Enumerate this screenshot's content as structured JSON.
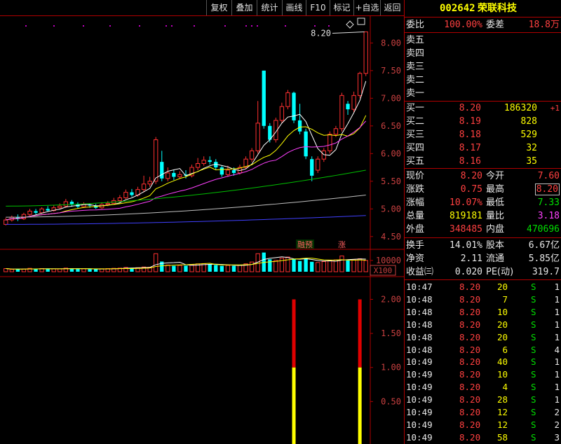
{
  "toolbar": {
    "buttons": [
      "复权",
      "叠加",
      "统计",
      "画线",
      "F10",
      "标记",
      "+自选",
      "返回"
    ]
  },
  "chart": {
    "price_axis": [
      "8.00",
      "7.50",
      "7.00",
      "6.50",
      "6.00",
      "5.50",
      "5.00",
      "4.50"
    ],
    "last_price_label": "8.20",
    "tag_left": "融预",
    "tag_right": "涨",
    "volume_axis": "10000",
    "volume_unit": "X100",
    "indicator_axis": [
      "2.00",
      "1.50",
      "1.00",
      "0.50"
    ],
    "colors": {
      "up": "#ff3030",
      "down": "#00ffff",
      "ma5": "#ffffff",
      "ma10": "#ffff00",
      "ma20": "#ff40ff",
      "ma30": "#00c000",
      "ma60": "#c0c0c0",
      "ma120": "#4040ff"
    },
    "candles": [
      {
        "o": 4.72,
        "c": 4.8,
        "h": 4.84,
        "l": 4.7
      },
      {
        "o": 4.8,
        "c": 4.85,
        "h": 4.88,
        "l": 4.77
      },
      {
        "o": 4.85,
        "c": 4.82,
        "h": 4.9,
        "l": 4.78
      },
      {
        "o": 4.82,
        "c": 4.9,
        "h": 4.93,
        "l": 4.8
      },
      {
        "o": 4.9,
        "c": 4.96,
        "h": 5.0,
        "l": 4.88
      },
      {
        "o": 4.96,
        "c": 4.93,
        "h": 5.0,
        "l": 4.9
      },
      {
        "o": 4.93,
        "c": 5.0,
        "h": 5.03,
        "l": 4.91
      },
      {
        "o": 5.0,
        "c": 4.97,
        "h": 5.05,
        "l": 4.95
      },
      {
        "o": 4.97,
        "c": 5.02,
        "h": 5.06,
        "l": 4.95
      },
      {
        "o": 5.02,
        "c": 5.05,
        "h": 5.1,
        "l": 5.0
      },
      {
        "o": 5.05,
        "c": 5.13,
        "h": 5.18,
        "l": 5.02
      },
      {
        "o": 5.13,
        "c": 5.08,
        "h": 5.16,
        "l": 5.04
      },
      {
        "o": 5.08,
        "c": 5.04,
        "h": 5.12,
        "l": 5.01
      },
      {
        "o": 5.04,
        "c": 5.08,
        "h": 5.12,
        "l": 5.02
      },
      {
        "o": 5.08,
        "c": 5.06,
        "h": 5.1,
        "l": 5.02
      },
      {
        "o": 5.06,
        "c": 5.02,
        "h": 5.09,
        "l": 5.0
      },
      {
        "o": 5.02,
        "c": 5.08,
        "h": 5.12,
        "l": 5.0
      },
      {
        "o": 5.08,
        "c": 5.1,
        "h": 5.14,
        "l": 5.05
      },
      {
        "o": 5.1,
        "c": 5.15,
        "h": 5.2,
        "l": 5.08
      },
      {
        "o": 5.15,
        "c": 5.2,
        "h": 5.25,
        "l": 5.12
      },
      {
        "o": 5.2,
        "c": 5.3,
        "h": 5.35,
        "l": 5.18
      },
      {
        "o": 5.3,
        "c": 5.25,
        "h": 5.36,
        "l": 5.22
      },
      {
        "o": 5.25,
        "c": 5.35,
        "h": 5.4,
        "l": 5.22
      },
      {
        "o": 5.35,
        "c": 5.45,
        "h": 5.6,
        "l": 5.3
      },
      {
        "o": 5.45,
        "c": 5.5,
        "h": 5.58,
        "l": 5.4
      },
      {
        "o": 5.5,
        "c": 6.25,
        "h": 6.3,
        "l": 5.45
      },
      {
        "o": 5.85,
        "c": 5.55,
        "h": 6.05,
        "l": 5.5
      },
      {
        "o": 5.55,
        "c": 5.65,
        "h": 5.75,
        "l": 5.5
      },
      {
        "o": 5.65,
        "c": 5.58,
        "h": 5.7,
        "l": 5.52
      },
      {
        "o": 5.58,
        "c": 5.62,
        "h": 5.68,
        "l": 5.55
      },
      {
        "o": 5.62,
        "c": 5.6,
        "h": 5.7,
        "l": 5.55
      },
      {
        "o": 5.6,
        "c": 5.75,
        "h": 5.8,
        "l": 5.57
      },
      {
        "o": 5.75,
        "c": 5.82,
        "h": 5.92,
        "l": 5.7
      },
      {
        "o": 5.82,
        "c": 5.88,
        "h": 5.95,
        "l": 5.78
      },
      {
        "o": 5.88,
        "c": 5.85,
        "h": 5.95,
        "l": 5.8
      },
      {
        "o": 5.85,
        "c": 5.75,
        "h": 5.9,
        "l": 5.7
      },
      {
        "o": 5.75,
        "c": 5.62,
        "h": 5.78,
        "l": 5.58
      },
      {
        "o": 5.62,
        "c": 5.7,
        "h": 5.78,
        "l": 5.58
      },
      {
        "o": 5.7,
        "c": 5.65,
        "h": 5.75,
        "l": 5.6
      },
      {
        "o": 5.65,
        "c": 5.75,
        "h": 5.8,
        "l": 5.62
      },
      {
        "o": 5.75,
        "c": 5.9,
        "h": 5.95,
        "l": 5.72
      },
      {
        "o": 5.9,
        "c": 6.05,
        "h": 6.1,
        "l": 5.85
      },
      {
        "o": 6.05,
        "c": 6.55,
        "h": 6.95,
        "l": 6.0
      },
      {
        "o": 7.5,
        "c": 6.5,
        "h": 7.5,
        "l": 6.45
      },
      {
        "o": 6.5,
        "c": 6.25,
        "h": 6.55,
        "l": 6.2
      },
      {
        "o": 6.25,
        "c": 6.6,
        "h": 6.65,
        "l": 6.2
      },
      {
        "o": 6.6,
        "c": 6.85,
        "h": 6.92,
        "l": 6.55
      },
      {
        "o": 6.85,
        "c": 7.1,
        "h": 7.15,
        "l": 6.8
      },
      {
        "o": 7.1,
        "c": 6.6,
        "h": 7.12,
        "l": 6.55
      },
      {
        "o": 6.6,
        "c": 6.4,
        "h": 6.9,
        "l": 6.35
      },
      {
        "o": 6.4,
        "c": 5.95,
        "h": 6.45,
        "l": 5.9
      },
      {
        "o": 5.9,
        "c": 5.6,
        "h": 5.95,
        "l": 5.5
      },
      {
        "o": 5.7,
        "c": 5.9,
        "h": 5.95,
        "l": 5.65
      },
      {
        "o": 5.9,
        "c": 6.05,
        "h": 6.1,
        "l": 5.85
      },
      {
        "o": 6.05,
        "c": 6.35,
        "h": 6.4,
        "l": 6.0
      },
      {
        "o": 6.35,
        "c": 6.45,
        "h": 6.5,
        "l": 6.3
      },
      {
        "o": 6.45,
        "c": 7.05,
        "h": 7.1,
        "l": 6.4
      },
      {
        "o": 6.9,
        "c": 6.8,
        "h": 6.95,
        "l": 6.7
      },
      {
        "o": 6.8,
        "c": 7.05,
        "h": 7.12,
        "l": 6.75
      },
      {
        "o": 7.05,
        "c": 7.45,
        "h": 7.48,
        "l": 7.0
      },
      {
        "o": 7.45,
        "c": 8.2,
        "h": 8.2,
        "l": 7.4
      }
    ],
    "volumes": [
      280,
      200,
      220,
      240,
      300,
      260,
      280,
      240,
      250,
      260,
      320,
      270,
      240,
      260,
      230,
      220,
      260,
      280,
      300,
      320,
      380,
      340,
      360,
      420,
      400,
      1600,
      900,
      600,
      520,
      560,
      540,
      620,
      700,
      720,
      680,
      600,
      520,
      560,
      520,
      580,
      700,
      860,
      1600,
      1700,
      1100,
      1000,
      1200,
      1300,
      1100,
      950,
      1200,
      880,
      820,
      900,
      1000,
      1050,
      1400,
      1000,
      1050,
      1150,
      1000
    ],
    "signals": [
      {
        "index": 48,
        "value": 2.0
      },
      {
        "index": 59,
        "value": 2.0
      }
    ]
  },
  "quote": {
    "code": "002642",
    "name": "荣联科技",
    "weibi_label": "委比",
    "weibi_value": "100.00%",
    "weicha_label": "委差",
    "weicha_value": "18.8万",
    "sell": [
      {
        "label": "卖五"
      },
      {
        "label": "卖四"
      },
      {
        "label": "卖三"
      },
      {
        "label": "卖二"
      },
      {
        "label": "卖一"
      }
    ],
    "buy": [
      {
        "label": "买一",
        "price": "8.20",
        "vol": "186320",
        "change": "+1"
      },
      {
        "label": "买二",
        "price": "8.19",
        "vol": "828",
        "change": ""
      },
      {
        "label": "买三",
        "price": "8.18",
        "vol": "529",
        "change": ""
      },
      {
        "label": "买四",
        "price": "8.17",
        "vol": "32",
        "change": ""
      },
      {
        "label": "买五",
        "price": "8.16",
        "vol": "35",
        "change": ""
      }
    ],
    "stats": {
      "xianjia_label": "现价",
      "xianjia": "8.20",
      "jinkai_label": "今开",
      "jinkai": "7.60",
      "zhangdie_label": "涨跌",
      "zhangdie": "0.75",
      "zuigao_label": "最高",
      "zuigao": "8.20",
      "zhangfu_label": "涨幅",
      "zhangfu": "10.07%",
      "zuidi_label": "最低",
      "zuidi": "7.33",
      "zongliang_label": "总量",
      "zongliang": "819181",
      "liangbi_label": "量比",
      "liangbi": "3.18",
      "waipan_label": "外盘",
      "waipan": "348485",
      "neipan_label": "内盘",
      "neipan": "470696",
      "huanshou_label": "换手",
      "huanshou": "14.01%",
      "guben_label": "股本",
      "guben": "6.67亿",
      "jingzi_label": "净资",
      "jingzi": "2.11",
      "liutong_label": "流通",
      "liutong": "5.85亿",
      "shouyi_label": "收益㈢",
      "shouyi": "0.020",
      "pe_label": "PE(动)",
      "pe": "319.7"
    },
    "ticks": [
      {
        "time": "10:47",
        "price": "8.20",
        "vol": "20",
        "dir": "S",
        "n": "1"
      },
      {
        "time": "10:48",
        "price": "8.20",
        "vol": "7",
        "dir": "S",
        "n": "1"
      },
      {
        "time": "10:48",
        "price": "8.20",
        "vol": "10",
        "dir": "S",
        "n": "1"
      },
      {
        "time": "10:48",
        "price": "8.20",
        "vol": "20",
        "dir": "S",
        "n": "1"
      },
      {
        "time": "10:48",
        "price": "8.20",
        "vol": "20",
        "dir": "S",
        "n": "1"
      },
      {
        "time": "10:48",
        "price": "8.20",
        "vol": "6",
        "dir": "S",
        "n": "4"
      },
      {
        "time": "10:49",
        "price": "8.20",
        "vol": "40",
        "dir": "S",
        "n": "1"
      },
      {
        "time": "10:49",
        "price": "8.20",
        "vol": "10",
        "dir": "S",
        "n": "1"
      },
      {
        "time": "10:49",
        "price": "8.20",
        "vol": "4",
        "dir": "S",
        "n": "1"
      },
      {
        "time": "10:49",
        "price": "8.20",
        "vol": "28",
        "dir": "S",
        "n": "1"
      },
      {
        "time": "10:49",
        "price": "8.20",
        "vol": "12",
        "dir": "S",
        "n": "2"
      },
      {
        "time": "10:49",
        "price": "8.20",
        "vol": "12",
        "dir": "S",
        "n": "2"
      },
      {
        "time": "10:49",
        "price": "8.20",
        "vol": "58",
        "dir": "S",
        "n": "3"
      }
    ]
  }
}
